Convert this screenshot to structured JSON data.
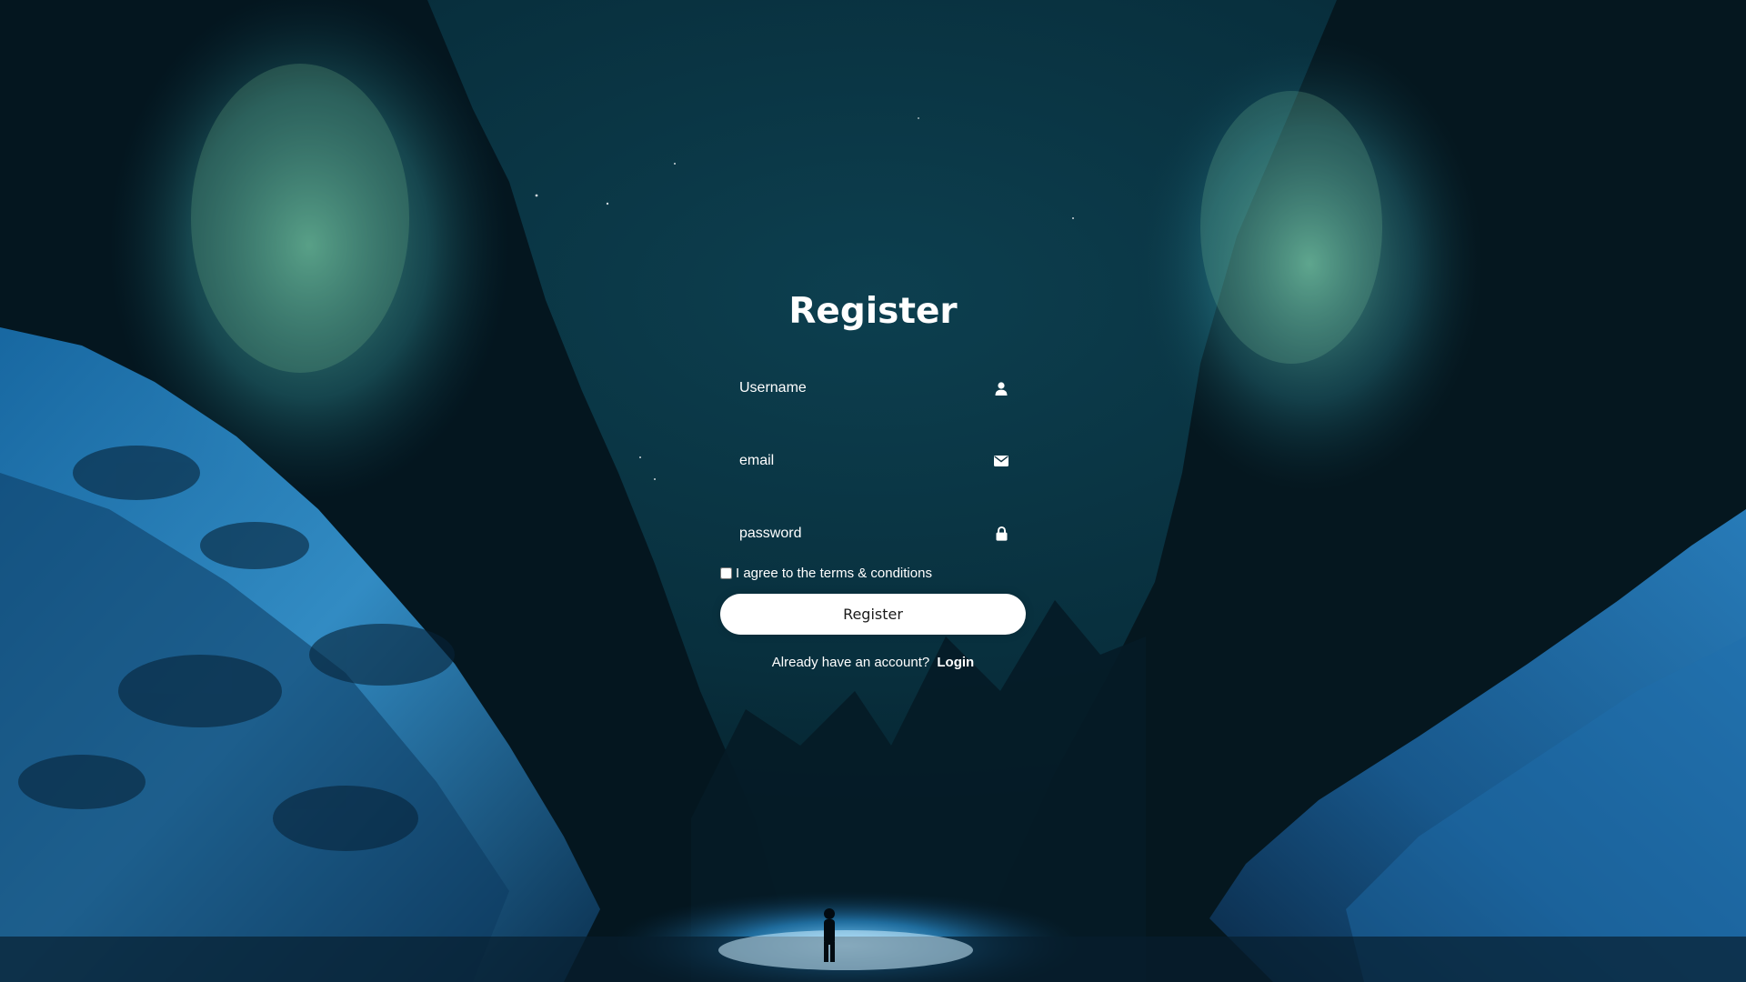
{
  "form": {
    "title": "Register",
    "username_placeholder": "Username",
    "email_placeholder": "email",
    "password_placeholder": "password",
    "terms_label": "I agree to the terms & conditions",
    "register_button_label": "Register",
    "login_prompt": "Already have an account?",
    "login_link_label": "Login"
  },
  "icons": {
    "username": "user-icon",
    "email": "envelope-icon",
    "password": "lock-icon"
  },
  "colors": {
    "text": "#ffffff",
    "button_bg": "#ffffff",
    "button_text": "#1b1b1b"
  }
}
